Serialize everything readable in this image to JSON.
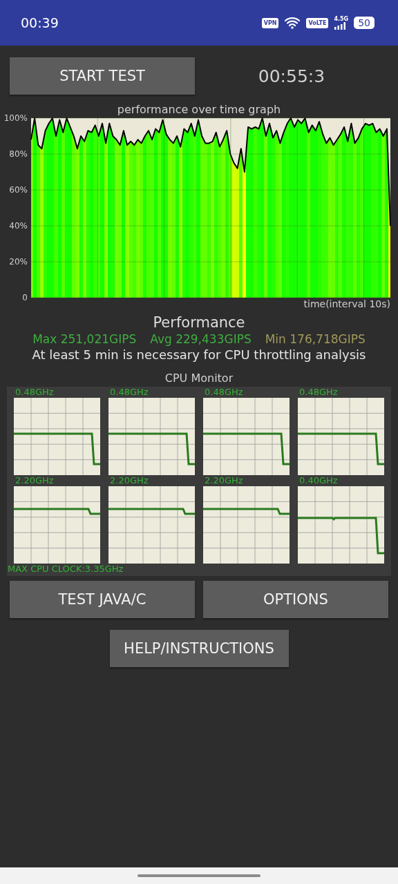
{
  "status_bar": {
    "time": "00:39",
    "vpn": "VPN",
    "volte": "VoLTE",
    "network": "4.5G",
    "battery": "50"
  },
  "start_button": "START TEST",
  "timer": "00:55:3",
  "performance_graph": {
    "chart_data": {
      "type": "line",
      "grid": true,
      "title": "performance over time graph",
      "xlabel": "time(interval 10s)",
      "ylim": [
        0,
        100
      ],
      "yticks": [
        {
          "value": 0,
          "label": "0"
        },
        {
          "value": 20,
          "label": "20%"
        },
        {
          "value": 40,
          "label": "40%"
        },
        {
          "value": 60,
          "label": "60%"
        },
        {
          "value": 80,
          "label": "80%"
        },
        {
          "value": 100,
          "label": "100%"
        }
      ],
      "series": [
        {
          "color": "#000000",
          "values": [
            88,
            100,
            85,
            83,
            93,
            97,
            100,
            90,
            99,
            92,
            100,
            95,
            90,
            83,
            90,
            87,
            93,
            92,
            96,
            90,
            97,
            86,
            97,
            90,
            88,
            85,
            93,
            85,
            87,
            85,
            88,
            86,
            90,
            93,
            88,
            94,
            92,
            99,
            91,
            88,
            86,
            90,
            84,
            94,
            92,
            97,
            90,
            99,
            90,
            86,
            86,
            87,
            92,
            84,
            88,
            93,
            80,
            75,
            72,
            83,
            70,
            95,
            94,
            95,
            94,
            100,
            90,
            97,
            89,
            93,
            86,
            92,
            97,
            100,
            95,
            99,
            97,
            100,
            92,
            96,
            93,
            98,
            91,
            86,
            89,
            85,
            88,
            91,
            95,
            87,
            97,
            86,
            89,
            94,
            97,
            96,
            97,
            92,
            94,
            90,
            94,
            40
          ]
        }
      ]
    }
  },
  "performance": {
    "title": "Performance",
    "max": "Max 251,021GIPS",
    "avg": "Avg 229,433GIPS",
    "min": "Min 176,718GIPS",
    "note": "At least 5 min is necessary for CPU throttling analysis"
  },
  "cpu_monitor": {
    "title": "CPU Monitor",
    "cores": [
      {
        "label": "0.48GHz",
        "kind": "steep"
      },
      {
        "label": "0.48GHz",
        "kind": "steep"
      },
      {
        "label": "0.48GHz",
        "kind": "steep"
      },
      {
        "label": "0.48GHz",
        "kind": "steep"
      },
      {
        "label": "2.20GHz",
        "kind": "slight"
      },
      {
        "label": "2.20GHz",
        "kind": "slight"
      },
      {
        "label": "2.20GHz",
        "kind": "slight"
      },
      {
        "label": "0.40GHz",
        "kind": "low"
      }
    ],
    "max_clock": "MAX CPU CLOCK:3.35GHz"
  },
  "buttons": [
    "TEST JAVA/C",
    "OPTIONS",
    "HELP/INSTRUCTIONS"
  ]
}
